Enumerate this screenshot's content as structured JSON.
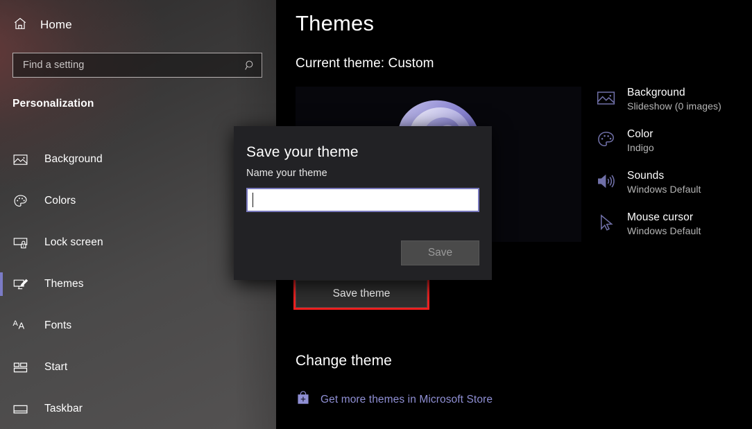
{
  "sidebar": {
    "home": {
      "label": "Home",
      "icon": "home-icon"
    },
    "search": {
      "placeholder": "Find a setting",
      "value": "",
      "icon": "search-icon"
    },
    "section_title": "Personalization",
    "items": [
      {
        "label": "Background",
        "icon": "image-icon",
        "selected": false
      },
      {
        "label": "Colors",
        "icon": "palette-icon",
        "selected": false
      },
      {
        "label": "Lock screen",
        "icon": "lock-screen-icon",
        "selected": false
      },
      {
        "label": "Themes",
        "icon": "themes-icon",
        "selected": true
      },
      {
        "label": "Fonts",
        "icon": "fonts-icon",
        "selected": false
      },
      {
        "label": "Start",
        "icon": "start-icon",
        "selected": false
      },
      {
        "label": "Taskbar",
        "icon": "taskbar-icon",
        "selected": false
      }
    ],
    "selected_accent": "#7b7bc6"
  },
  "main": {
    "page_title": "Themes",
    "current_theme": "Current theme: Custom",
    "preview": {
      "icon": "theme-preview-image",
      "alt": "Windows bloom wallpaper"
    },
    "settings": [
      {
        "name": "Background",
        "value": "Slideshow (0 images)",
        "icon": "image-icon"
      },
      {
        "name": "Color",
        "value": "Indigo",
        "icon": "palette-icon"
      },
      {
        "name": "Sounds",
        "value": "Windows Default",
        "icon": "speaker-icon"
      },
      {
        "name": "Mouse cursor",
        "value": "Windows Default",
        "icon": "cursor-icon"
      }
    ],
    "save_theme_label": "Save theme",
    "highlight_color": "#ef2020",
    "change_theme_heading": "Change theme",
    "store_link": {
      "label": "Get more themes in Microsoft Store",
      "icon": "store-bag-icon",
      "color": "#8f8fd4"
    }
  },
  "dialog": {
    "title": "Save your theme",
    "subtitle": "Name your theme",
    "input": {
      "value": "",
      "placeholder": ""
    },
    "save_label": "Save",
    "save_enabled": false,
    "accent": "#7878bd"
  }
}
